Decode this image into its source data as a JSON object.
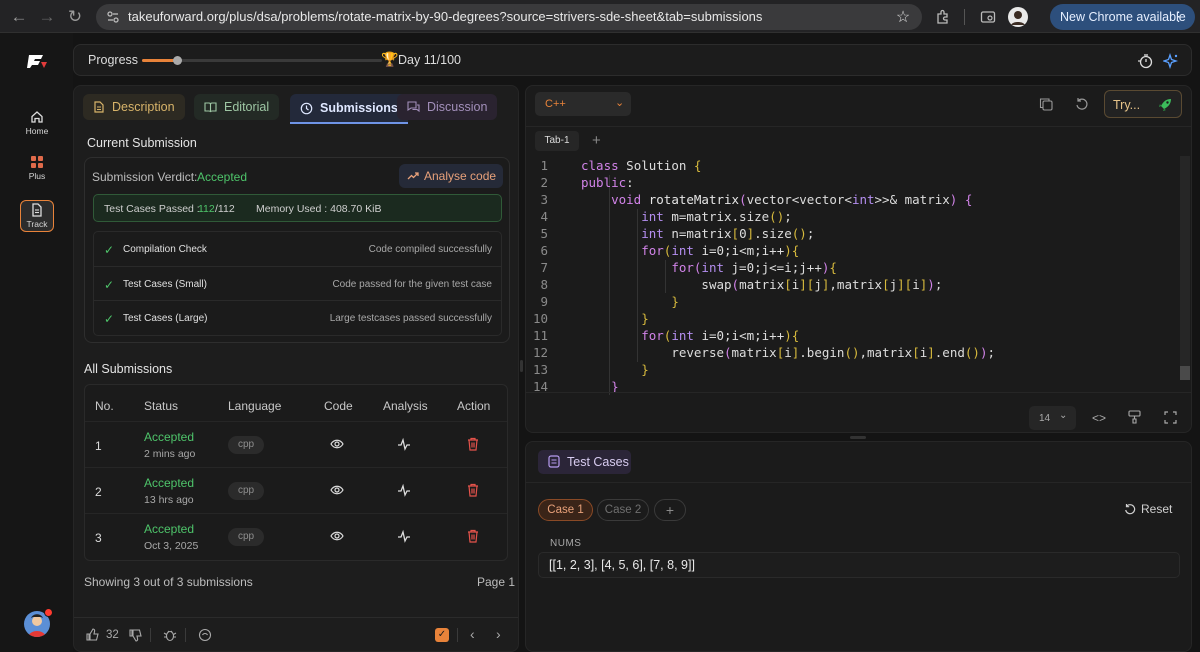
{
  "browser": {
    "url": "takeuforward.org/plus/dsa/problems/rotate-matrix-by-90-degrees?source=strivers-sde-sheet&tab=submissions",
    "update_label": "New Chrome available"
  },
  "sidebar": {
    "items": [
      {
        "label": "Home"
      },
      {
        "label": "Plus"
      },
      {
        "label": "Track"
      }
    ]
  },
  "progress": {
    "label": "Progress",
    "day": "Day 11/100",
    "fraction": 0.22
  },
  "left": {
    "tabs": [
      "Description",
      "Editorial",
      "Submissions",
      "Discussion"
    ],
    "current_title": "Current Submission",
    "verdict_label": "Submission Verdict:",
    "verdict": "Accepted",
    "analyse": "Analyse code",
    "tc_label": "Test Cases Passed :",
    "tc_value": "112",
    "tc_total": "/112",
    "mem": "Memory Used : 408.70 KiB",
    "checks": [
      {
        "name": "Compilation Check",
        "desc": "Code compiled successfully"
      },
      {
        "name": "Test Cases (Small)",
        "desc": "Code passed for the given test case"
      },
      {
        "name": "Test Cases (Large)",
        "desc": "Large testcases passed successfully"
      }
    ],
    "all_title": "All Submissions",
    "headers": [
      "No.",
      "Status",
      "Language",
      "Code",
      "Analysis",
      "Action"
    ],
    "rows": [
      {
        "no": "1",
        "status": "Accepted",
        "time": "2 mins ago",
        "lang": "cpp"
      },
      {
        "no": "2",
        "status": "Accepted",
        "time": "13 hrs ago",
        "lang": "cpp"
      },
      {
        "no": "3",
        "status": "Accepted",
        "time": "Oct 3, 2025",
        "lang": "cpp"
      }
    ],
    "showing": "Showing 3 out of 3 submissions",
    "page": "Page 1",
    "likes": "32"
  },
  "editor": {
    "language": "C++",
    "try": "Try...",
    "tab": "Tab-1",
    "font_size": "14",
    "line_numbers": [
      "1",
      "2",
      "3",
      "4",
      "5",
      "6",
      "7",
      "8",
      "9",
      "10",
      "11",
      "12",
      "13",
      "14"
    ]
  },
  "testcases": {
    "title": "Test Cases",
    "cases": [
      "Case 1",
      "Case 2"
    ],
    "reset": "Reset",
    "param": "NUMS",
    "value": "[[1, 2, 3], [4, 5, 6], [7, 8, 9]]"
  },
  "colors": {
    "accent": "#e8833a",
    "accepted": "#4ec46a",
    "brand": "#2d4f7c"
  }
}
